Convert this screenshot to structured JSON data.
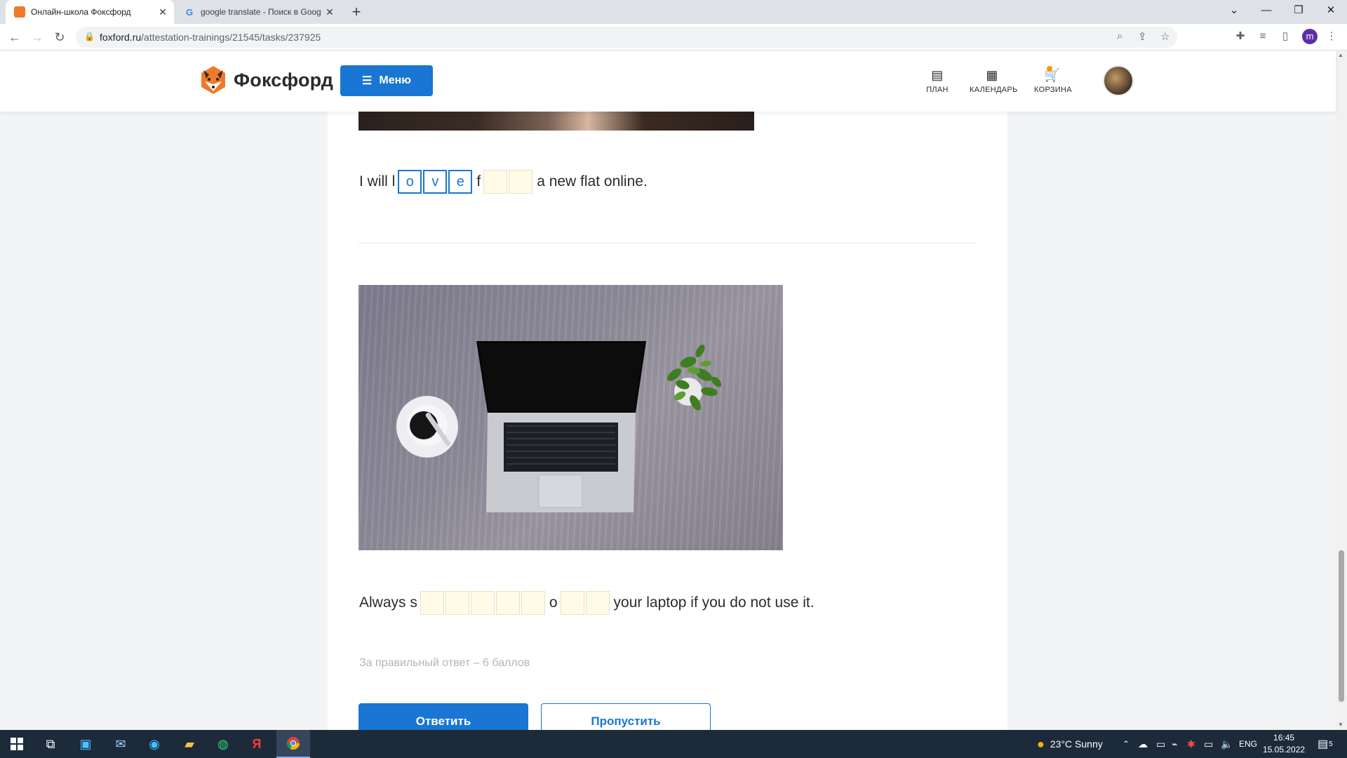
{
  "browser": {
    "tabs": [
      {
        "title": "Онлайн-школа Фоксфорд",
        "active": true
      },
      {
        "title": "google translate - Поиск в Goog",
        "active": false
      }
    ],
    "url_host": "foxford.ru",
    "url_path": "/attestation-trainings/21545/tasks/237925",
    "profile_initial": "m"
  },
  "header": {
    "logo_text": "Фоксфорд",
    "menu_label": "Меню",
    "nav": [
      {
        "label": "ПЛАН",
        "icon": "plan-icon"
      },
      {
        "label": "КАЛЕНДАРЬ",
        "icon": "calendar-icon"
      },
      {
        "label": "КОРЗИНА",
        "icon": "cart-icon"
      }
    ]
  },
  "task1": {
    "prefix": "I will l",
    "word1_letters": [
      "o",
      "v",
      "e"
    ],
    "word2_prefix": "f",
    "word2_empty_count": 2,
    "suffix": "a new flat online."
  },
  "task2": {
    "prefix": "Always s",
    "word1_empty_count": 5,
    "word2_prefix": "o",
    "word2_empty_count": 2,
    "suffix": "your laptop if you do not use it."
  },
  "points_text": "За правильный ответ – 6 баллов",
  "buttons": {
    "answer": "Ответить",
    "skip": "Пропустить"
  },
  "taskbar": {
    "weather": "23°C Sunny",
    "lang": "ENG",
    "time": "16:45",
    "date": "15.05.2022",
    "notifications": "5"
  },
  "colors": {
    "brand_blue": "#1976d2",
    "empty_cell_bg": "#fffbe6",
    "cart_dot": "#ff9800"
  }
}
